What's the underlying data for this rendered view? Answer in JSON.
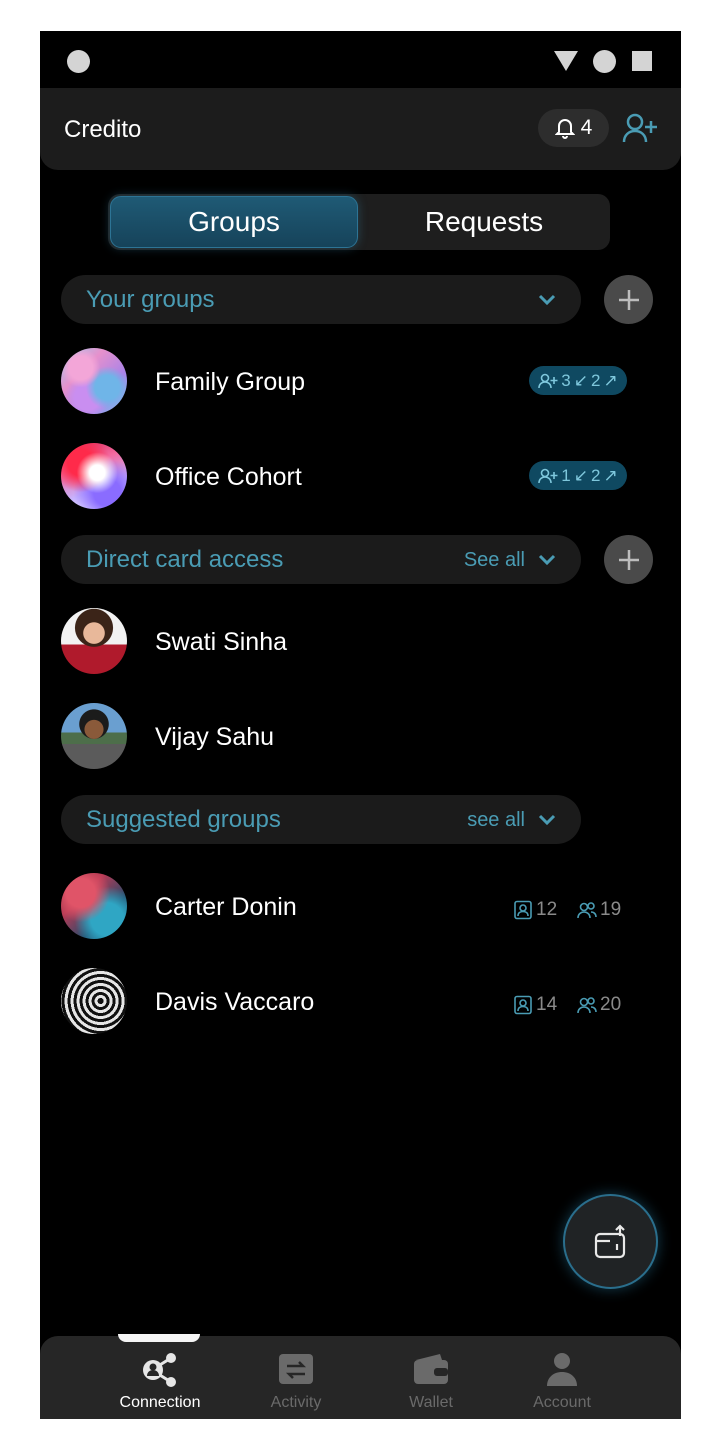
{
  "header": {
    "title": "Credito",
    "notification_count": "4"
  },
  "tabs": {
    "groups": "Groups",
    "requests": "Requests"
  },
  "your_groups": {
    "label": "Your groups",
    "items": [
      {
        "name": "Family Group",
        "stat_a": "3",
        "stat_b": "2"
      },
      {
        "name": "Office Cohort",
        "stat_a": "1",
        "stat_b": "2"
      }
    ]
  },
  "direct_card_access": {
    "label": "Direct card access",
    "see_all": "See all",
    "items": [
      {
        "name": "Swati Sinha"
      },
      {
        "name": "Vijay Sahu"
      }
    ]
  },
  "suggested_groups": {
    "label": "Suggested groups",
    "see_all": "see all",
    "items": [
      {
        "name": "Carter Donin",
        "cards": "12",
        "members": "19"
      },
      {
        "name": "Davis Vaccaro",
        "cards": "14",
        "members": "20"
      }
    ]
  },
  "bottom_nav": [
    {
      "label": "Connection",
      "icon": "connection-icon",
      "active": true
    },
    {
      "label": "Activity",
      "icon": "activity-icon",
      "active": false
    },
    {
      "label": "Wallet",
      "icon": "wallet-icon",
      "active": false
    },
    {
      "label": "Account",
      "icon": "account-icon",
      "active": false
    }
  ],
  "colors": {
    "accent": "#4a9cb4",
    "badge_bg": "#0f4961",
    "background": "#000000"
  }
}
